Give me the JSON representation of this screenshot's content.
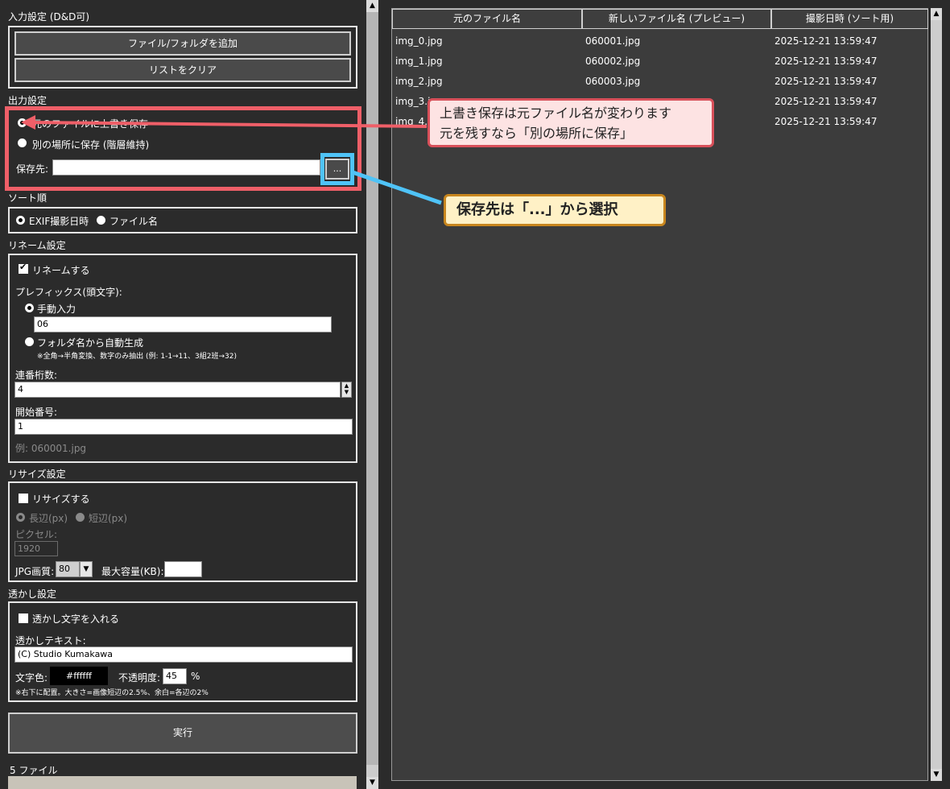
{
  "input_section": {
    "title": "入力設定 (D&D可)",
    "add_button": "ファイル/フォルダを追加",
    "clear_button": "リストをクリア"
  },
  "output_section": {
    "title": "出力設定",
    "overwrite_option": "元のファイルに上書き保存",
    "other_location_option": "別の場所に保存 (階層維持)",
    "dest_label": "保存先:",
    "dest_value": "",
    "browse_button": "..."
  },
  "sort_section": {
    "title": "ソート順",
    "exif_option": "EXIF撮影日時",
    "filename_option": "ファイル名"
  },
  "rename_section": {
    "title": "リネーム設定",
    "rename_checkbox": "リネームする",
    "prefix_label": "プレフィックス(頭文字):",
    "manual_option": "手動入力",
    "prefix_value": "06",
    "auto_option": "フォルダ名から自動生成",
    "auto_note": "※全角→半角変換、数字のみ抽出 (例: 1-1→11、3組2班→32)",
    "digits_label": "連番桁数:",
    "digits_value": "4",
    "start_label": "開始番号:",
    "start_value": "1",
    "example": "例: 060001.jpg"
  },
  "resize_section": {
    "title": "リサイズ設定",
    "resize_checkbox": "リサイズする",
    "long_side_option": "長辺(px)",
    "short_side_option": "短辺(px)",
    "pixel_label": "ピクセル:",
    "pixel_value": "1920",
    "jpg_quality_label": "JPG画質:",
    "jpg_quality_value": "80",
    "max_size_label": "最大容量(KB):",
    "max_size_value": ""
  },
  "watermark_section": {
    "title": "透かし設定",
    "watermark_checkbox": "透かし文字を入れる",
    "text_label": "透かしテキスト:",
    "text_value": "(C) Studio Kumakawa",
    "color_label": "文字色:",
    "color_value": "#ffffff",
    "opacity_label": "不透明度:",
    "opacity_value": "45",
    "opacity_unit": "%",
    "note": "※右下に配置。大きさ=画像短辺の2.5%、余白=各辺の2%"
  },
  "run_button": "実行",
  "file_count": "5 ファイル",
  "file_table": {
    "headers": [
      "元のファイル名",
      "新しいファイル名 (プレビュー)",
      "撮影日時 (ソート用)"
    ],
    "rows": [
      [
        "img_0.jpg",
        "060001.jpg",
        "2025-12-21 13:59:47"
      ],
      [
        "img_1.jpg",
        "060002.jpg",
        "2025-12-21 13:59:47"
      ],
      [
        "img_2.jpg",
        "060003.jpg",
        "2025-12-21 13:59:47"
      ],
      [
        "img_3.jpg",
        "",
        "2025-12-21 13:59:47"
      ],
      [
        "img_4.jpg",
        "",
        "2025-12-21 13:59:47"
      ]
    ]
  },
  "callouts": {
    "overwrite_line1": "上書き保存は元ファイル名が変わります",
    "overwrite_line2": "元を残すなら「別の場所に保存」",
    "browse_tip": "保存先は「...」から選択"
  },
  "colors": {
    "background": "#2b2b2b",
    "highlight_red": "#ef5f68",
    "highlight_blue": "#4fc3f7",
    "callout_pink": "#fde3e3",
    "callout_yellow": "#fff1c6"
  }
}
